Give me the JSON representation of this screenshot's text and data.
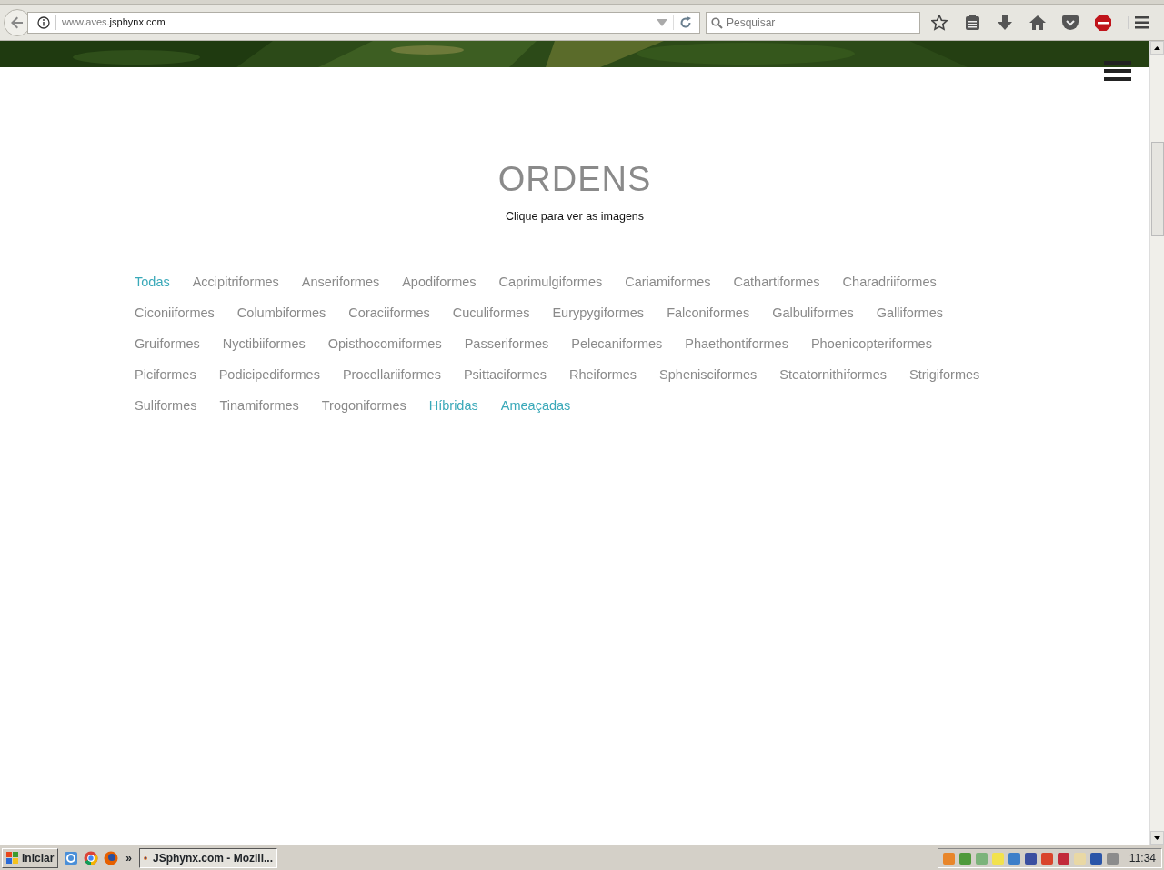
{
  "browser": {
    "url_host_prefix": "www.aves.",
    "url_domain": "jsphynx.com",
    "search_placeholder": "Pesquisar"
  },
  "page": {
    "title": "ORDENS",
    "subtitle": "Clique para ver as imagens",
    "filters": [
      {
        "label": "Todas",
        "kind": "filter",
        "selected": true
      },
      {
        "label": "Accipitriformes",
        "kind": "filter",
        "selected": false
      },
      {
        "label": "Anseriformes",
        "kind": "filter",
        "selected": false
      },
      {
        "label": "Apodiformes",
        "kind": "filter",
        "selected": false
      },
      {
        "label": "Caprimulgiformes",
        "kind": "filter",
        "selected": false
      },
      {
        "label": "Cariamiformes",
        "kind": "filter",
        "selected": false
      },
      {
        "label": "Cathartiformes",
        "kind": "filter",
        "selected": false
      },
      {
        "label": "Charadriiformes",
        "kind": "filter",
        "selected": false
      },
      {
        "label": "Ciconiiformes",
        "kind": "filter",
        "selected": false
      },
      {
        "label": "Columbiformes",
        "kind": "filter",
        "selected": false
      },
      {
        "label": "Coraciiformes",
        "kind": "filter",
        "selected": false
      },
      {
        "label": "Cuculiformes",
        "kind": "filter",
        "selected": false
      },
      {
        "label": "Eurypygiformes",
        "kind": "filter",
        "selected": false
      },
      {
        "label": "Falconiformes",
        "kind": "filter",
        "selected": false
      },
      {
        "label": "Galbuliformes",
        "kind": "filter",
        "selected": false
      },
      {
        "label": "Galliformes",
        "kind": "filter",
        "selected": false
      },
      {
        "label": "Gruiformes",
        "kind": "filter",
        "selected": false
      },
      {
        "label": "Nyctibiiformes",
        "kind": "filter",
        "selected": false
      },
      {
        "label": "Opisthocomiformes",
        "kind": "filter",
        "selected": false
      },
      {
        "label": "Passeriformes",
        "kind": "filter",
        "selected": false
      },
      {
        "label": "Pelecaniformes",
        "kind": "filter",
        "selected": false
      },
      {
        "label": "Phaethontiformes",
        "kind": "filter",
        "selected": false
      },
      {
        "label": "Phoenicopteriformes",
        "kind": "filter",
        "selected": false
      },
      {
        "label": "Piciformes",
        "kind": "filter",
        "selected": false
      },
      {
        "label": "Podicipediformes",
        "kind": "filter",
        "selected": false
      },
      {
        "label": "Procellariiformes",
        "kind": "filter",
        "selected": false
      },
      {
        "label": "Psittaciformes",
        "kind": "filter",
        "selected": false
      },
      {
        "label": "Rheiformes",
        "kind": "filter",
        "selected": false
      },
      {
        "label": "Sphenisciformes",
        "kind": "filter",
        "selected": false
      },
      {
        "label": "Steatornithiformes",
        "kind": "filter",
        "selected": false
      },
      {
        "label": "Strigiformes",
        "kind": "filter",
        "selected": false
      },
      {
        "label": "Suliformes",
        "kind": "filter",
        "selected": false
      },
      {
        "label": "Tinamiformes",
        "kind": "filter",
        "selected": false
      },
      {
        "label": "Trogoniformes",
        "kind": "filter",
        "selected": false
      },
      {
        "label": "Híbridas",
        "kind": "link"
      },
      {
        "label": "Ameaçadas",
        "kind": "link"
      }
    ]
  },
  "taskbar": {
    "start": "Iniciar",
    "overflow": "»",
    "task": "JSphynx.com - Mozill...",
    "clock": "11:34"
  }
}
